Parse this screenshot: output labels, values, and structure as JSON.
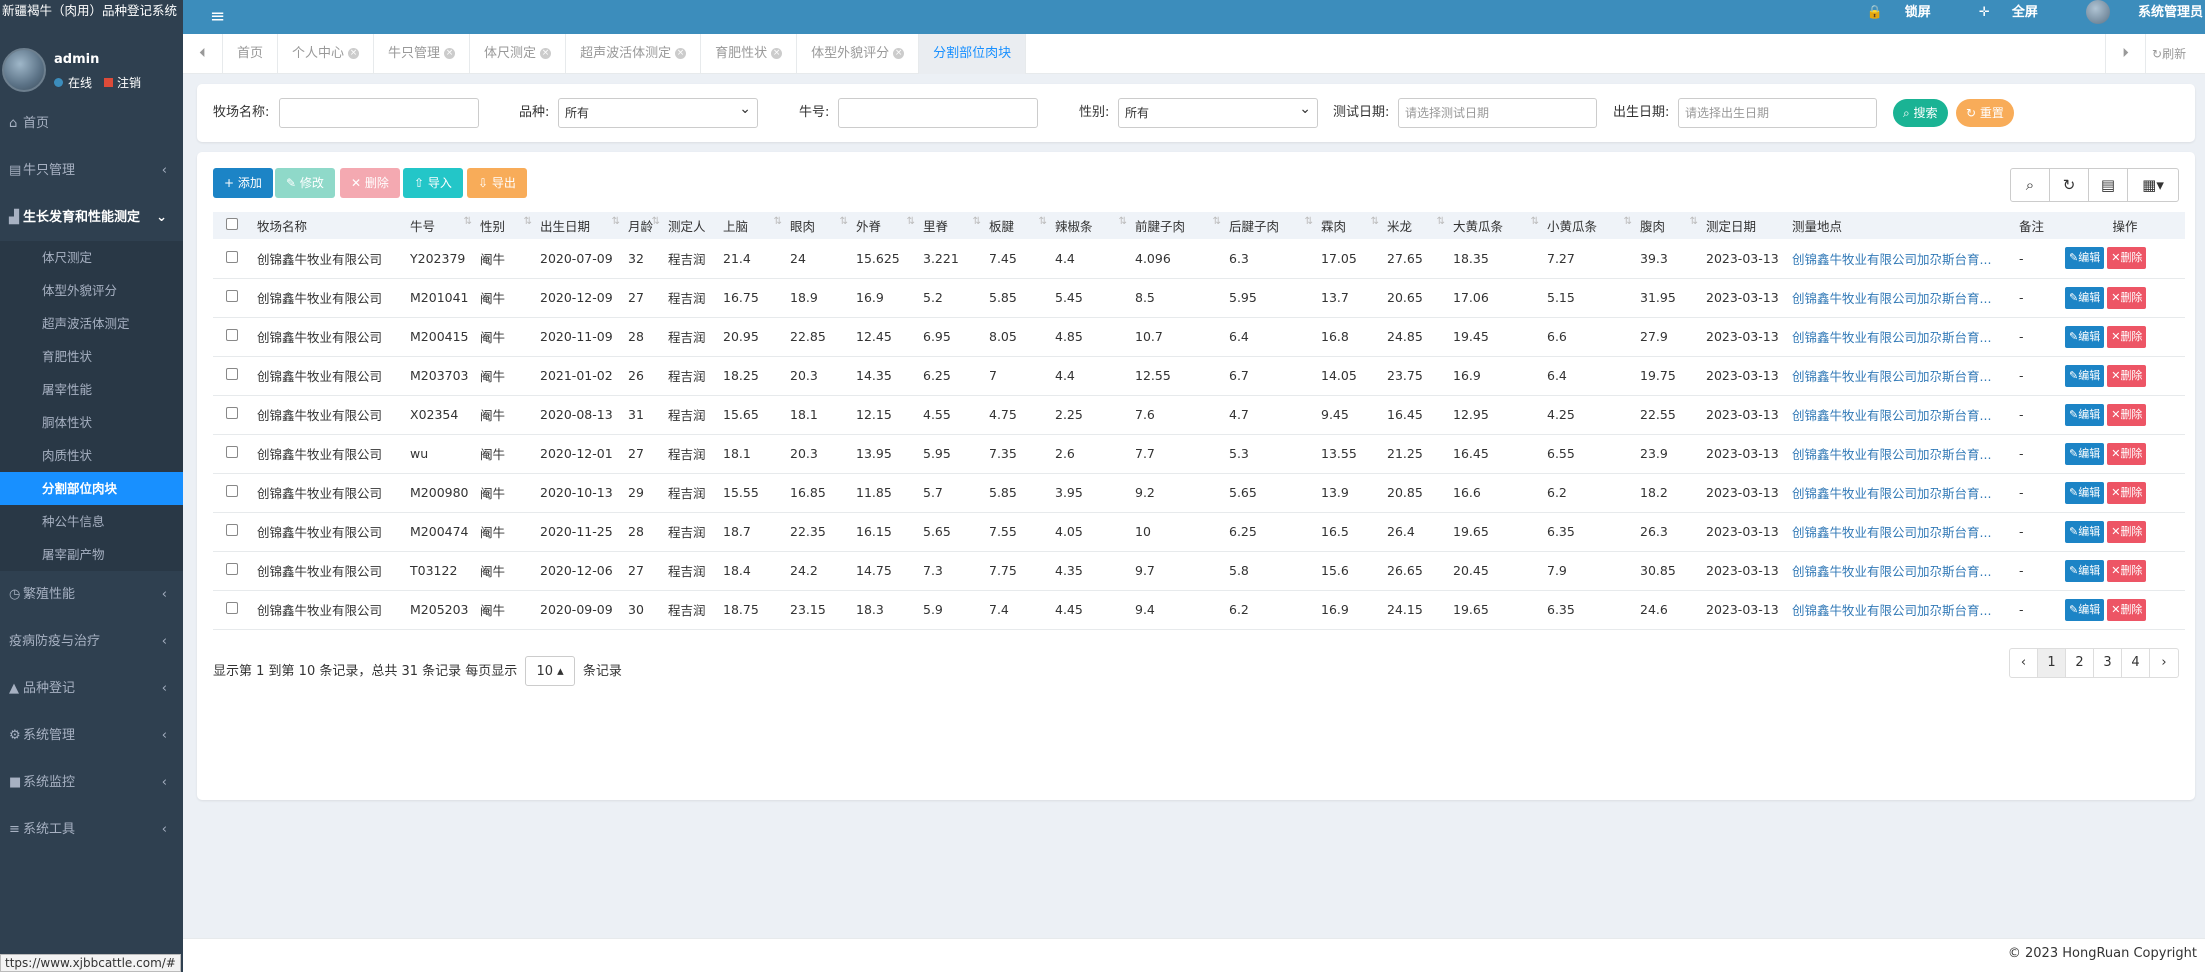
{
  "app": {
    "title": "新疆褐牛（肉用）品种登记系统"
  },
  "user": {
    "name": "admin",
    "online": "在线",
    "logout": "注销"
  },
  "nav": {
    "home": "首页",
    "cattle": "牛只管理",
    "growth": "生长发育和性能测定",
    "growth_items": [
      "体尺测定",
      "体型外貌评分",
      "超声波活体测定",
      "育肥性状",
      "屠宰性能",
      "胴体性状",
      "肉质性状",
      "分割部位肉块",
      "种公牛信息",
      "屠宰副产物"
    ],
    "breeding": "繁殖性能",
    "disease": "疫病防疫与治疗",
    "register": "品种登记",
    "system": "系统管理",
    "monitor": "系统监控",
    "tools": "系统工具"
  },
  "status_url": "ttps://www.xjbbcattle.com/#",
  "topbar": {
    "lock": "锁屏",
    "fullscreen": "全屏",
    "admin": "系统管理员"
  },
  "tabs": [
    "首页",
    "个人中心",
    "牛只管理",
    "体尺测定",
    "超声波活体测定",
    "育肥性状",
    "体型外貌评分",
    "分割部位肉块"
  ],
  "refresh": "刷新",
  "search": {
    "farm_label": "牧场名称:",
    "breed_label": "品种:",
    "breed_value": "所有",
    "no_label": "牛号:",
    "sex_label": "性别:",
    "sex_value": "所有",
    "test_label": "测试日期:",
    "test_ph": "请选择测试日期",
    "birth_label": "出生日期:",
    "birth_ph": "请选择出生日期",
    "search_btn": "搜索",
    "reset_btn": "重置"
  },
  "toolbar": {
    "add": "添加",
    "edit": "修改",
    "delete": "删除",
    "import": "导入",
    "export": "导出"
  },
  "table": {
    "headers": [
      "牧场名称",
      "牛号",
      "性别",
      "出生日期",
      "月龄",
      "测定人",
      "上脑",
      "眼肉",
      "外脊",
      "里脊",
      "板腱",
      "辣椒条",
      "前腱子肉",
      "后腱子肉",
      "霖肉",
      "米龙",
      "大黄瓜条",
      "小黄瓜条",
      "腹肉",
      "测定日期",
      "测量地点",
      "备注",
      "操作"
    ],
    "edit": "编辑",
    "del": "删除",
    "rows": [
      [
        "创锦鑫牛牧业有限公司",
        "Y202379",
        "阉牛",
        "2020-07-09",
        "32",
        "程吉润",
        "21.4",
        "24",
        "15.625",
        "3.221",
        "7.45",
        "4.4",
        "4.096",
        "6.3",
        "17.05",
        "27.65",
        "18.35",
        "7.27",
        "39.3",
        "2023-03-13",
        "创锦鑫牛牧业有限公司加尕斯台育...",
        "-"
      ],
      [
        "创锦鑫牛牧业有限公司",
        "M201041",
        "阉牛",
        "2020-12-09",
        "27",
        "程吉润",
        "16.75",
        "18.9",
        "16.9",
        "5.2",
        "5.85",
        "5.45",
        "8.5",
        "5.95",
        "13.7",
        "20.65",
        "17.06",
        "5.15",
        "31.95",
        "2023-03-13",
        "创锦鑫牛牧业有限公司加尕斯台育...",
        "-"
      ],
      [
        "创锦鑫牛牧业有限公司",
        "M200415",
        "阉牛",
        "2020-11-09",
        "28",
        "程吉润",
        "20.95",
        "22.85",
        "12.45",
        "6.95",
        "8.05",
        "4.85",
        "10.7",
        "6.4",
        "16.8",
        "24.85",
        "19.45",
        "6.6",
        "27.9",
        "2023-03-13",
        "创锦鑫牛牧业有限公司加尕斯台育...",
        "-"
      ],
      [
        "创锦鑫牛牧业有限公司",
        "M203703",
        "阉牛",
        "2021-01-02",
        "26",
        "程吉润",
        "18.25",
        "20.3",
        "14.35",
        "6.25",
        "7",
        "4.4",
        "12.55",
        "6.7",
        "14.05",
        "23.75",
        "16.9",
        "6.4",
        "19.75",
        "2023-03-13",
        "创锦鑫牛牧业有限公司加尕斯台育...",
        "-"
      ],
      [
        "创锦鑫牛牧业有限公司",
        "X02354",
        "阉牛",
        "2020-08-13",
        "31",
        "程吉润",
        "15.65",
        "18.1",
        "12.15",
        "4.55",
        "4.75",
        "2.25",
        "7.6",
        "4.7",
        "9.45",
        "16.45",
        "12.95",
        "4.25",
        "22.55",
        "2023-03-13",
        "创锦鑫牛牧业有限公司加尕斯台育...",
        "-"
      ],
      [
        "创锦鑫牛牧业有限公司",
        "wu",
        "阉牛",
        "2020-12-01",
        "27",
        "程吉润",
        "18.1",
        "20.3",
        "13.95",
        "5.95",
        "7.35",
        "2.6",
        "7.7",
        "5.3",
        "13.55",
        "21.25",
        "16.45",
        "6.55",
        "23.9",
        "2023-03-13",
        "创锦鑫牛牧业有限公司加尕斯台育...",
        "-"
      ],
      [
        "创锦鑫牛牧业有限公司",
        "M200980",
        "阉牛",
        "2020-10-13",
        "29",
        "程吉润",
        "15.55",
        "16.85",
        "11.85",
        "5.7",
        "5.85",
        "3.95",
        "9.2",
        "5.65",
        "13.9",
        "20.85",
        "16.6",
        "6.2",
        "18.2",
        "2023-03-13",
        "创锦鑫牛牧业有限公司加尕斯台育...",
        "-"
      ],
      [
        "创锦鑫牛牧业有限公司",
        "M200474",
        "阉牛",
        "2020-11-25",
        "28",
        "程吉润",
        "18.7",
        "22.35",
        "16.15",
        "5.65",
        "7.55",
        "4.05",
        "10",
        "6.25",
        "16.5",
        "26.4",
        "19.65",
        "6.35",
        "26.3",
        "2023-03-13",
        "创锦鑫牛牧业有限公司加尕斯台育...",
        "-"
      ],
      [
        "创锦鑫牛牧业有限公司",
        "T03122",
        "阉牛",
        "2020-12-06",
        "27",
        "程吉润",
        "18.4",
        "24.2",
        "14.75",
        "7.3",
        "7.75",
        "4.35",
        "9.7",
        "5.8",
        "15.6",
        "26.65",
        "20.45",
        "7.9",
        "30.85",
        "2023-03-13",
        "创锦鑫牛牧业有限公司加尕斯台育...",
        "-"
      ],
      [
        "创锦鑫牛牧业有限公司",
        "M205203",
        "阉牛",
        "2020-09-09",
        "30",
        "程吉润",
        "18.75",
        "23.15",
        "18.3",
        "5.9",
        "7.4",
        "4.45",
        "9.4",
        "6.2",
        "16.9",
        "24.15",
        "19.65",
        "6.35",
        "24.6",
        "2023-03-13",
        "创锦鑫牛牧业有限公司加尕斯台育...",
        "-"
      ]
    ]
  },
  "footer": {
    "summary": "显示第 1 到第 10 条记录，总共 31 条记录",
    "per_page_pre": "每页显示",
    "per_page": "10",
    "per_page_post": "条记录"
  },
  "pager": [
    "‹",
    "1",
    "2",
    "3",
    "4",
    "›"
  ],
  "copyright": "© 2023 HongRuan Copyright"
}
